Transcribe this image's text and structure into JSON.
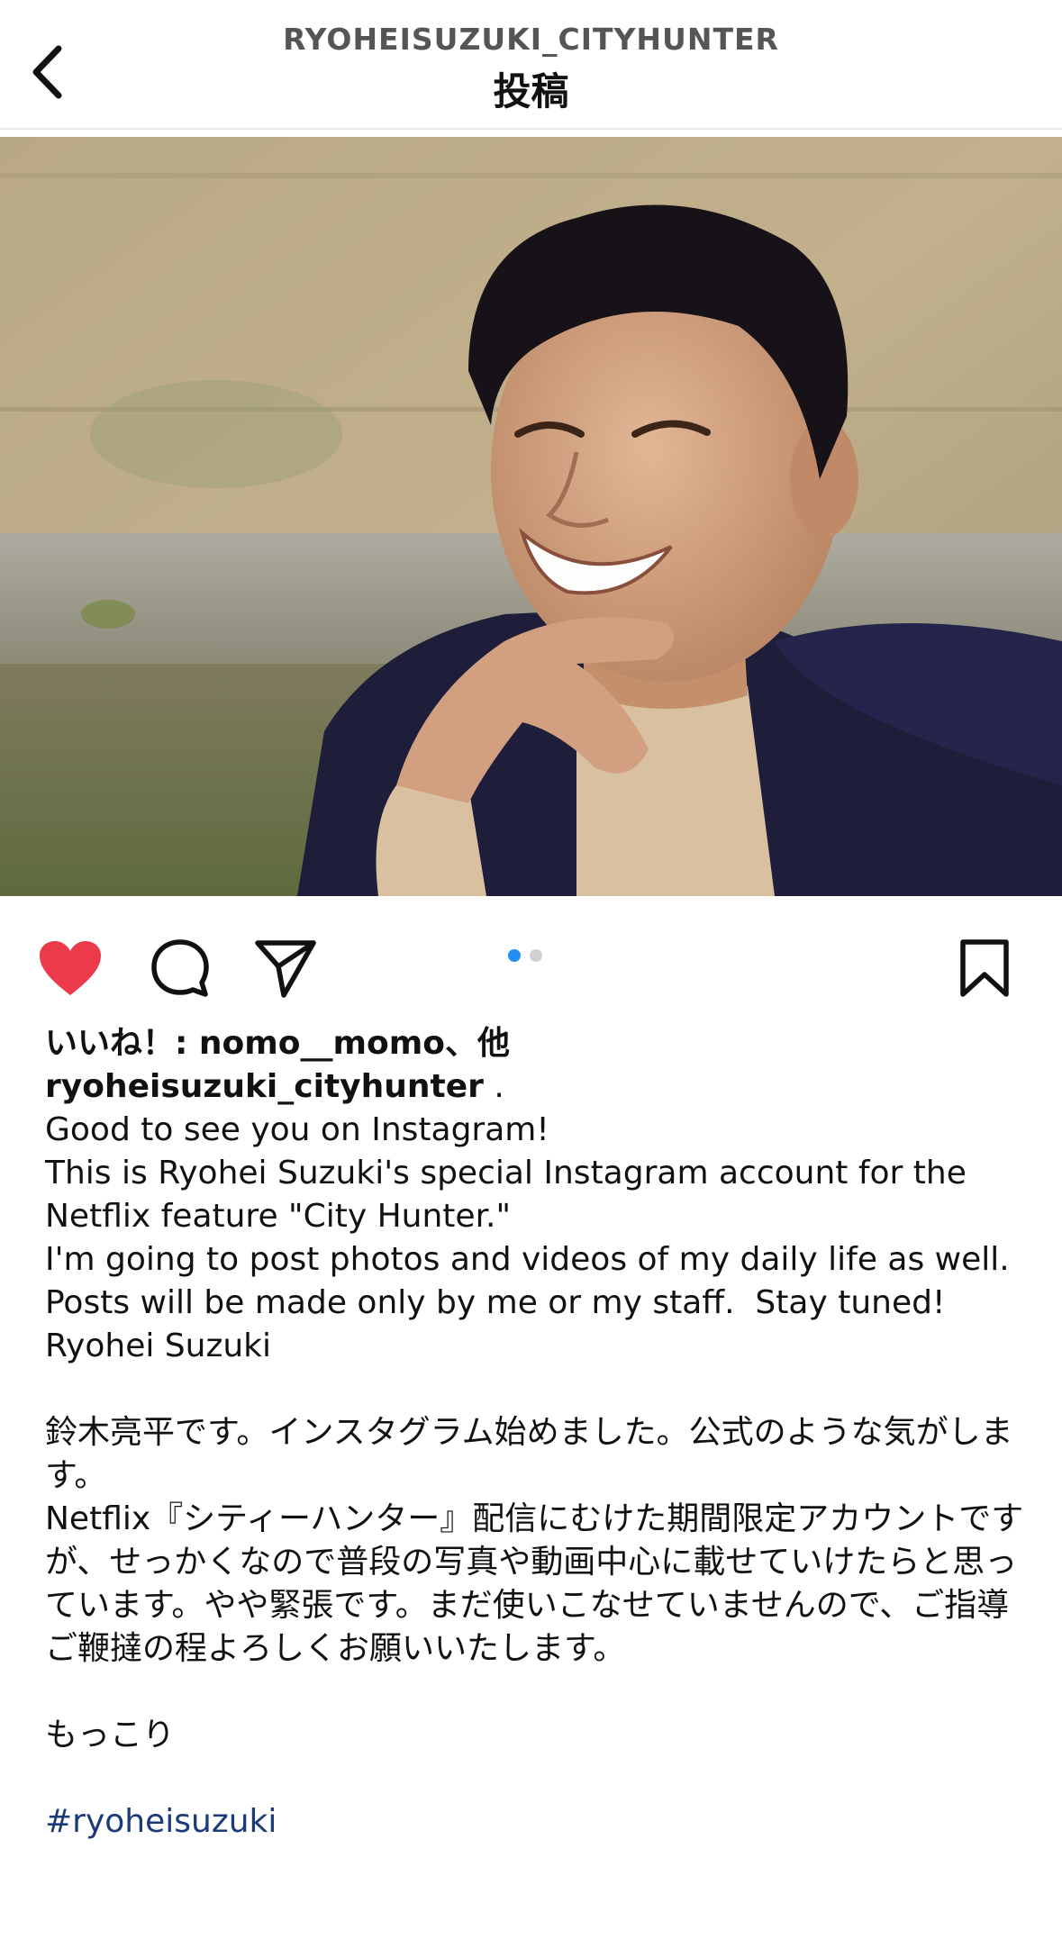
{
  "header": {
    "username": "RYOHEISUZUKI_CITYHUNTER",
    "title": "投稿"
  },
  "post": {
    "carousel": {
      "total": 2,
      "current": 1
    },
    "liked": true,
    "accent_colors": {
      "like": "#ed3a4a",
      "dot_active": "#1e8ff0",
      "hashtag": "#1b3a78"
    },
    "icons": [
      "back-chevron-icon",
      "heart-icon",
      "comment-icon",
      "share-icon",
      "bookmark-icon"
    ],
    "likes_text": "いいね！: nomo__momo、他",
    "caption_username": "ryoheisuzuki_cityhunter",
    "caption_username_suffix": " .",
    "caption_en": [
      "Good to see you on Instagram!",
      "This is Ryohei Suzuki's special Instagram account for the Netflix feature \"City Hunter.\"",
      "I'm going to post photos and videos of my daily life as well. Posts will be made only by me or my staff.  Stay tuned!",
      "Ryohei Suzuki"
    ],
    "caption_jp": [
      "鈴木亮平です。インスタグラム始めました。公式のような気がします。",
      "Netflix『シティーハンター』配信にむけた期間限定アカウントですが、せっかくなので普段の写真や動画中心に載せていけたらと思っています。やや緊張です。まだ使いこなせていませんので、ご指導ご鞭撻の程よろしくお願いいたします。"
    ],
    "closing": "もっこり",
    "hashtag": "#ryoheisuzuki"
  }
}
